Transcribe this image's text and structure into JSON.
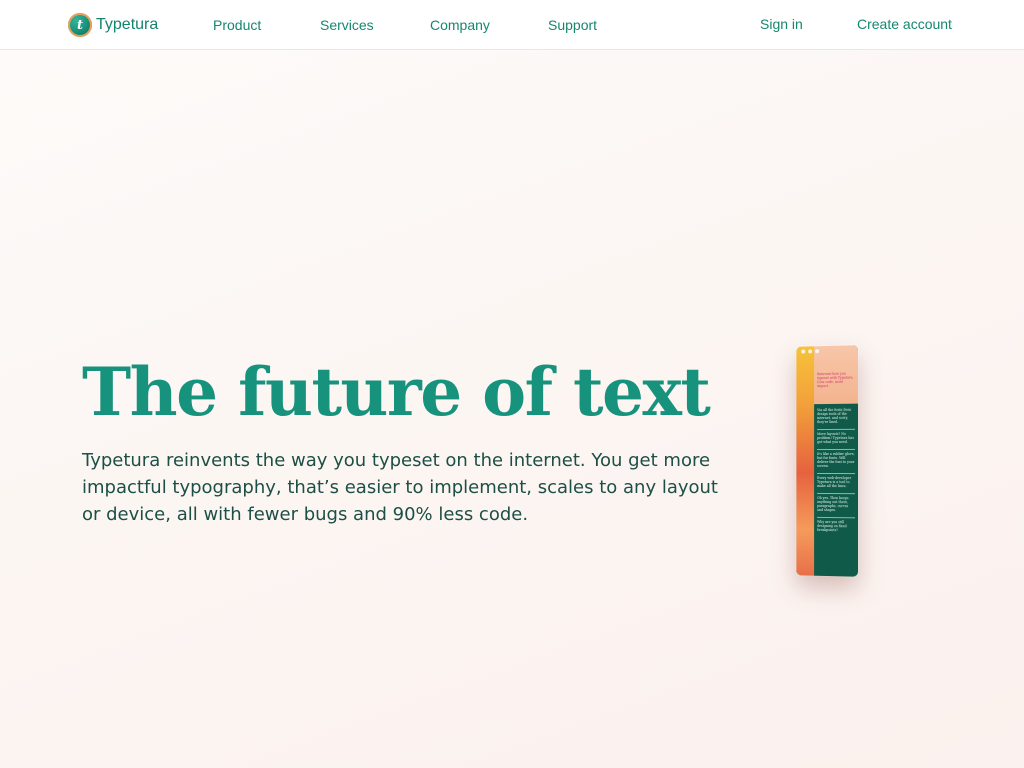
{
  "nav": {
    "brand": {
      "initial": "t",
      "name": "Typetura"
    },
    "links": [
      "Product",
      "Services",
      "Company",
      "Support"
    ],
    "sign_in": "Sign in",
    "create_account": "Create account"
  },
  "hero": {
    "title": "The future of text",
    "description": "Typetura reinvents the way you typeset on the internet. You get more impactful typography, that’s easier to implement, scales to any layout or device, all with fewer bugs and 90% less code."
  },
  "preview": {
    "promo": "Reinvent how you typeset with Typetura. Less code, more impact.",
    "items": [
      "Via all the fonts from design tools of the internet, and sorry, they're lined.",
      "Move layouts? No problem! Typetura has got what you need.",
      "It's like a rubber glove, but for fonts. Will deliver the font to your screen.",
      "Every web-developer Typetura is a tool to make all the lines.",
      "Oh yes, Then keeps anything out there, paragraphs, curves and shapes.",
      "Why are you still designing on fixed breakpoints?"
    ]
  },
  "colors": {
    "accent": "#17927d",
    "link": "#16876f",
    "body_text": "#1c4f45",
    "logo_ring": "#e8a15c"
  }
}
